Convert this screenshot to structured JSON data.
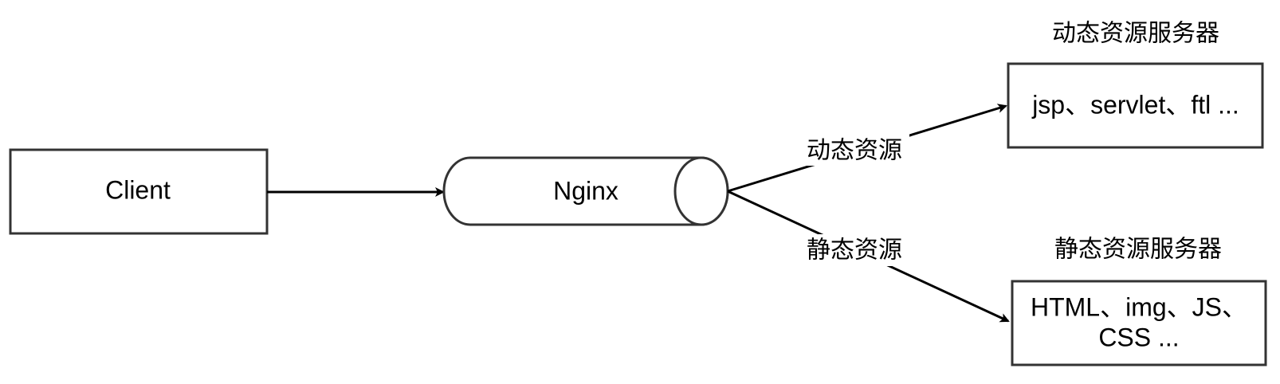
{
  "colors": {
    "background": "#ffffff",
    "stroke": "#333333",
    "text": "#000000"
  },
  "nodes": {
    "client": {
      "label": "Client"
    },
    "nginx": {
      "label": "Nginx"
    },
    "dynamic_server": {
      "title": "动态资源服务器",
      "label": "jsp、servlet、ftl ..."
    },
    "static_server": {
      "title": "静态资源服务器",
      "label_line1": "HTML、img、JS、",
      "label_line2": "CSS ..."
    }
  },
  "edges": {
    "client_to_nginx": {
      "label": ""
    },
    "nginx_to_dynamic": {
      "label": "动态资源"
    },
    "nginx_to_static": {
      "label": "静态资源"
    }
  }
}
